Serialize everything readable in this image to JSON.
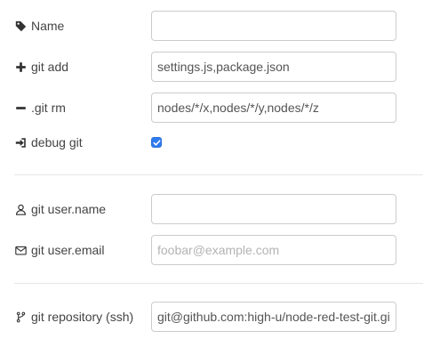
{
  "form": {
    "name": {
      "label": "Name",
      "value": "",
      "icon": "tag-icon"
    },
    "git_add": {
      "label": "git add",
      "value": "settings.js,package.json",
      "icon": "plus-icon"
    },
    "git_rm": {
      "label": ".git rm",
      "value": "nodes/*/x,nodes/*/y,nodes/*/z",
      "icon": "minus-icon"
    },
    "debug_git": {
      "label": "debug git",
      "checked": true,
      "icon": "sign-in-icon"
    },
    "user_name": {
      "label": "git user.name",
      "value": "",
      "icon": "user-icon"
    },
    "user_email": {
      "label": "git user.email",
      "value": "",
      "placeholder": "foobar@example.com",
      "icon": "envelope-icon"
    },
    "repository": {
      "label": "git repository (ssh)",
      "value": "git@github.com:high-u/node-red-test-git.git",
      "icon": "code-fork-icon"
    }
  },
  "colors": {
    "checkbox_accent": "#2f7bf0",
    "border": "#cccccc",
    "divider": "#e6e6e6"
  }
}
